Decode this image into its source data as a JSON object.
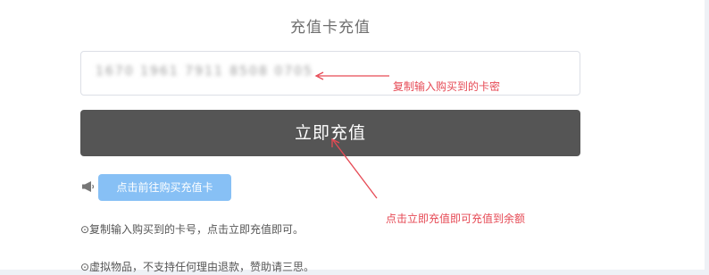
{
  "page": {
    "title": "充值卡充值"
  },
  "card_input": {
    "value": "1670 1961 7911 8508 0705"
  },
  "submit_button": {
    "label": "立即充值"
  },
  "goto_buy_button": {
    "label": "点击前往购买充值卡"
  },
  "notes": [
    "⊙复制输入购买到的卡号，点击立即充值即可。",
    "⊙虚拟物品，不支持任何理由退款，赞助请三思。"
  ],
  "annotations": [
    "复制输入购买到的卡密",
    "点击立即充值即可充值到余额"
  ],
  "icons": {
    "speaker": "speaker-icon"
  },
  "colors": {
    "submit_button_bg": "#555555",
    "goto_buy_button_bg": "#87c0f5",
    "annotation": "#e64a55"
  }
}
